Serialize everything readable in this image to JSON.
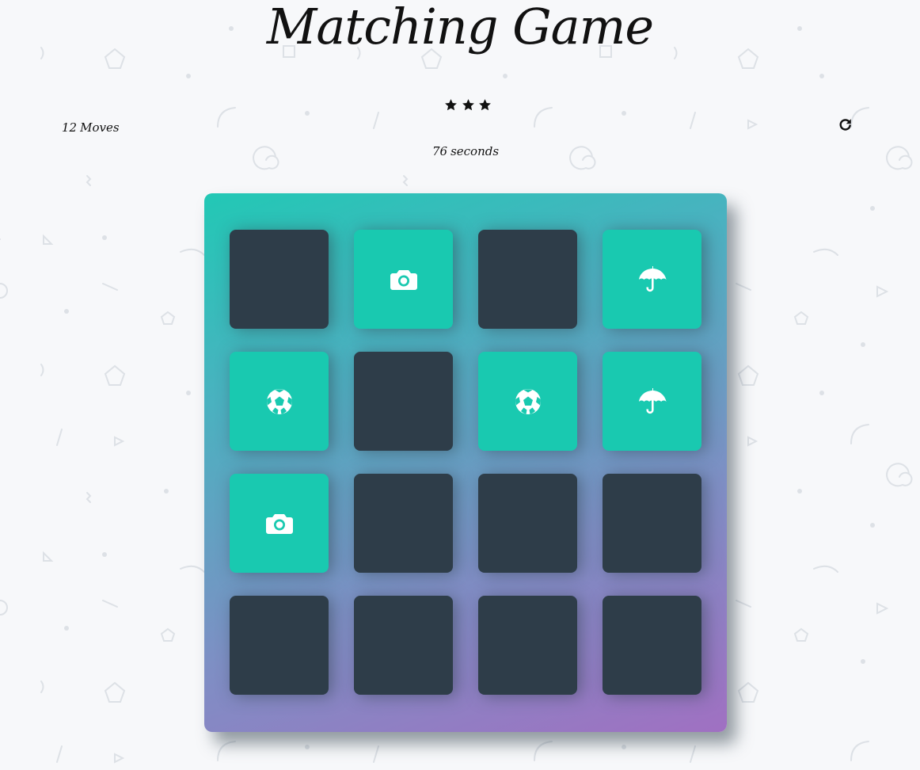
{
  "title": "Matching Game",
  "rating": {
    "stars": 3,
    "star_icon": "star-icon",
    "star_color": "#111111"
  },
  "moves": {
    "count": "12",
    "label": "Moves"
  },
  "timer": {
    "value": "76",
    "unit": "seconds"
  },
  "restart": {
    "icon": "repeat-icon"
  },
  "colors": {
    "card_back": "#2e3d49",
    "card_match": "#19c9b0",
    "deck_gradient_start": "#22c8b5",
    "deck_gradient_end": "#a070c2",
    "page_background": "#f7f8fa"
  },
  "deck": {
    "rows": 4,
    "columns": 4,
    "cards": [
      {
        "state": "hidden",
        "icon": null
      },
      {
        "state": "match",
        "icon": "camera-icon"
      },
      {
        "state": "hidden",
        "icon": null
      },
      {
        "state": "match",
        "icon": "umbrella-icon"
      },
      {
        "state": "match",
        "icon": "soccer-ball-icon"
      },
      {
        "state": "hidden",
        "icon": null
      },
      {
        "state": "match",
        "icon": "soccer-ball-icon"
      },
      {
        "state": "match",
        "icon": "umbrella-icon"
      },
      {
        "state": "match",
        "icon": "camera-icon"
      },
      {
        "state": "hidden",
        "icon": null
      },
      {
        "state": "hidden",
        "icon": null
      },
      {
        "state": "hidden",
        "icon": null
      },
      {
        "state": "hidden",
        "icon": null
      },
      {
        "state": "hidden",
        "icon": null
      },
      {
        "state": "hidden",
        "icon": null
      },
      {
        "state": "hidden",
        "icon": null
      }
    ]
  }
}
